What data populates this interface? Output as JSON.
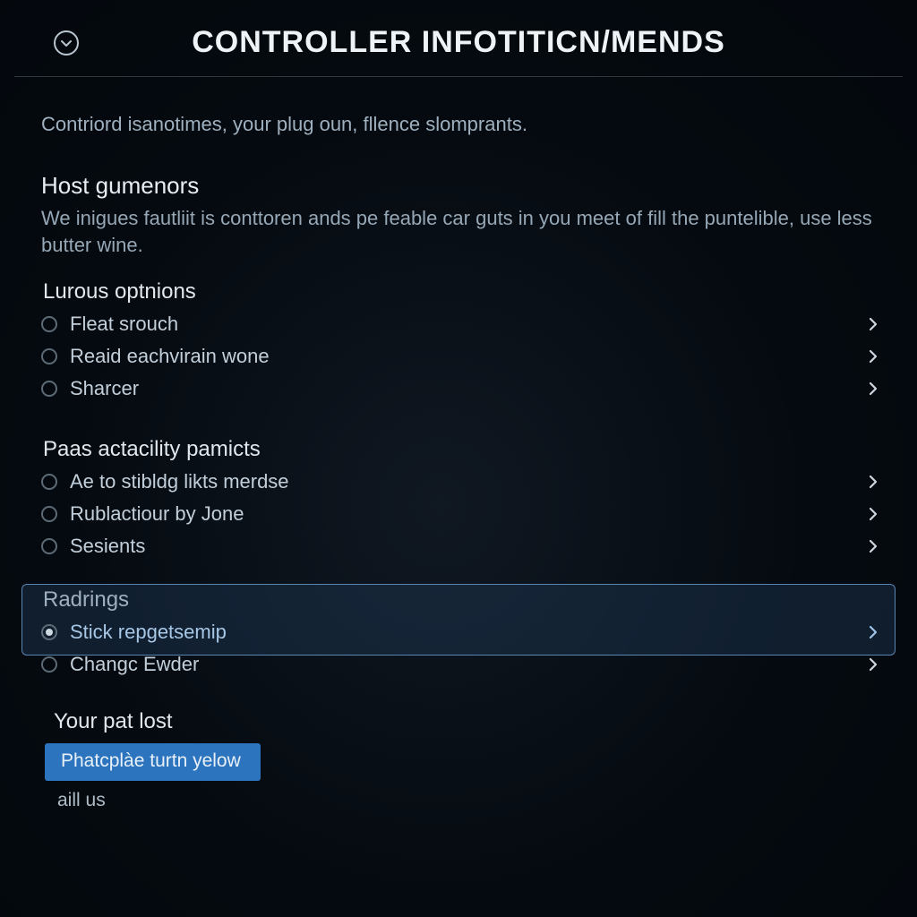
{
  "header": {
    "title": "CONTROLLER INFOTITICN/MENDS"
  },
  "intro": "Contriord isanotimes, your plug oun, fllence slomprants.",
  "host": {
    "heading": "Host gumenors",
    "desc": "We inigues fautliit is conttoren ands pe feable car guts in you meet of fill the puntelible, use less butter wine."
  },
  "groups": [
    {
      "heading": "Lurous optnions",
      "items": [
        {
          "label": "Fleat srouch"
        },
        {
          "label": "Reaid eachvirain wone"
        },
        {
          "label": "Sharcer"
        }
      ]
    },
    {
      "heading": "Paas actacility pamicts",
      "items": [
        {
          "label": "Ae to stibldg likts merdse"
        },
        {
          "label": "Rublactiour by Jone"
        },
        {
          "label": "Sesients"
        }
      ]
    },
    {
      "heading": "Radrings",
      "highlighted": true,
      "items": [
        {
          "label": "Stick repgetsemip",
          "checked": true,
          "hl": true
        },
        {
          "label": "Changc Ewder"
        }
      ]
    }
  ],
  "yourlost": {
    "heading": "Your pat lost",
    "pill": "Phatcplàe turtn yelow",
    "sub": "aill us"
  }
}
